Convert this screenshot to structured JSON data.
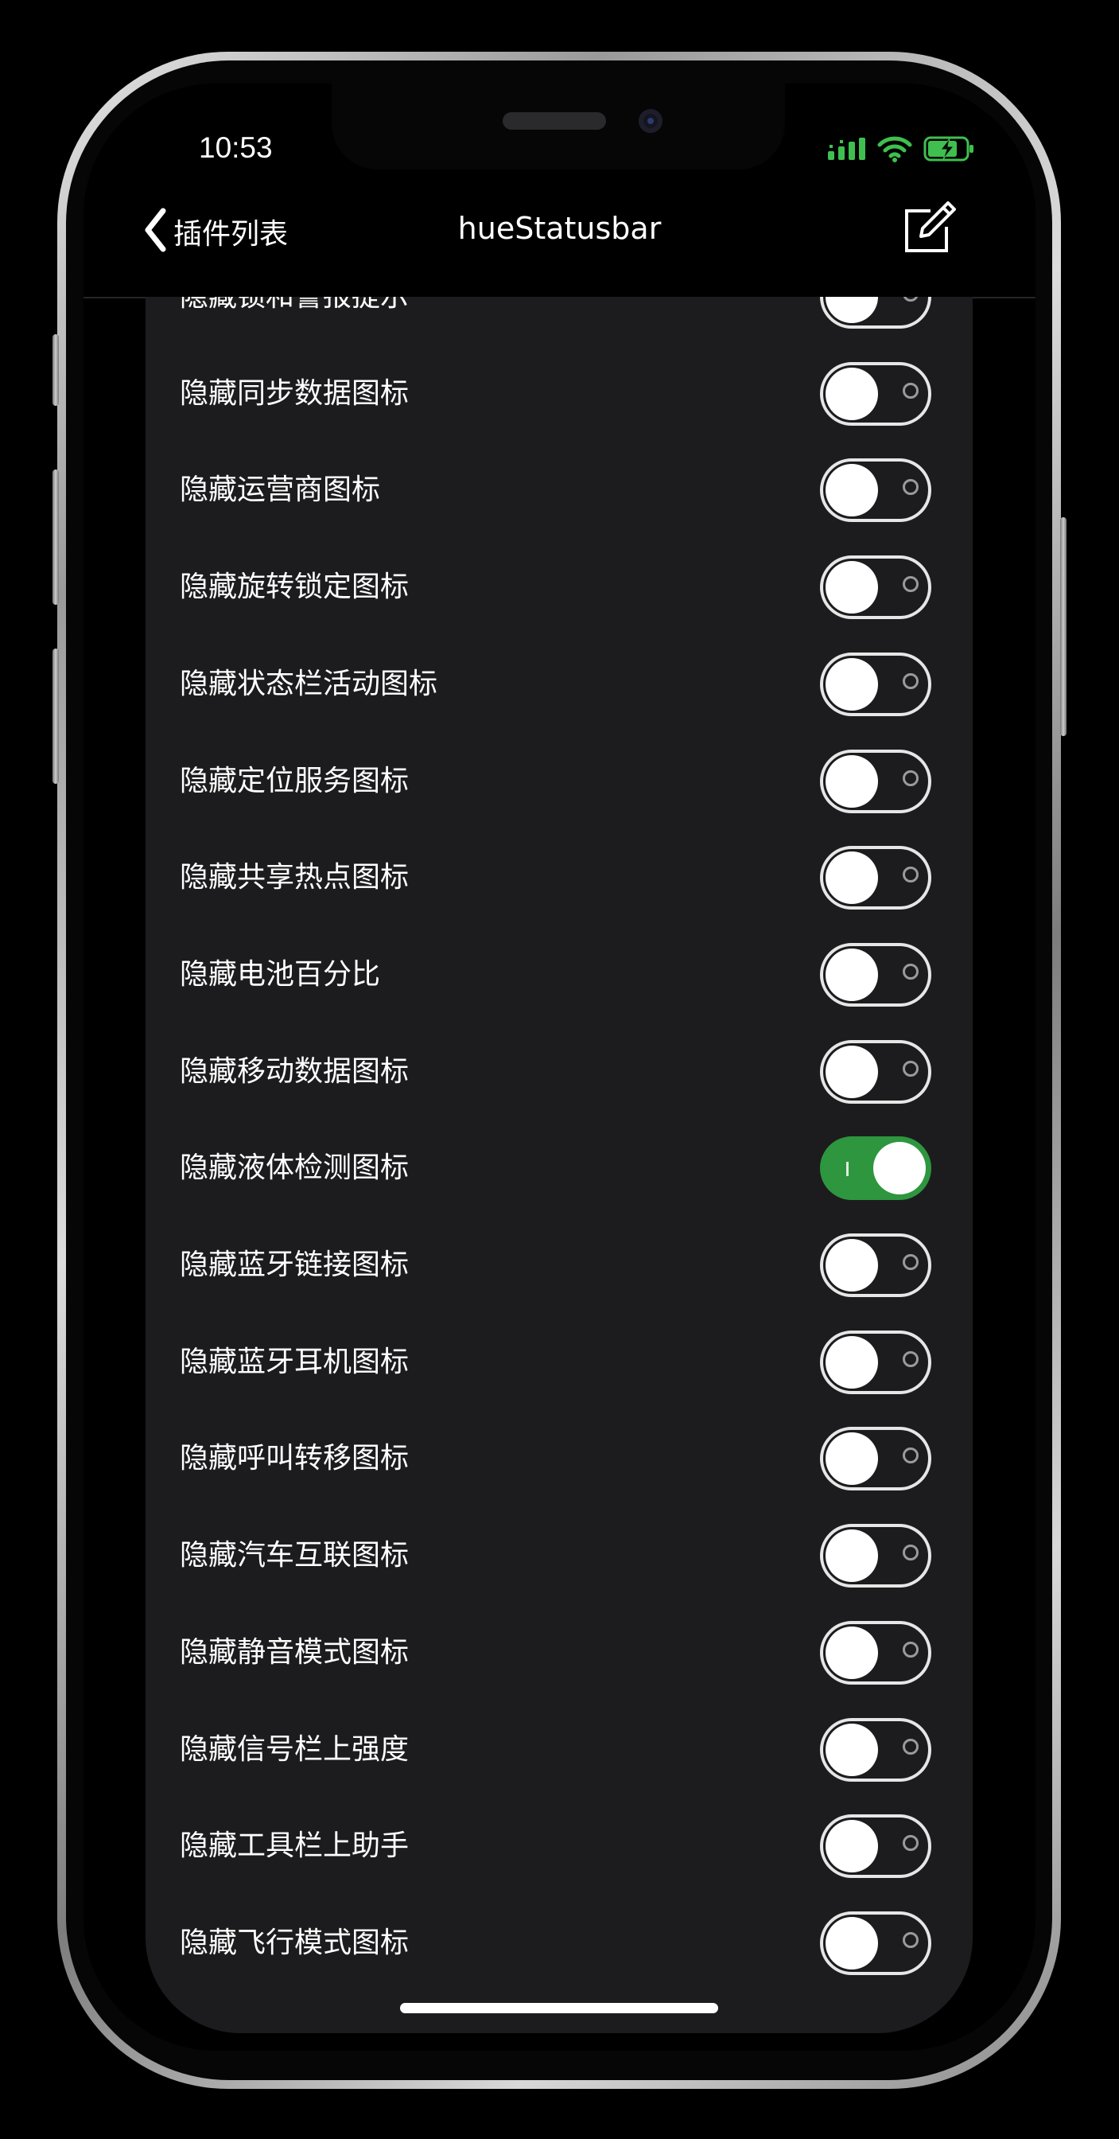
{
  "status_bar": {
    "time": "10:53"
  },
  "nav": {
    "back_label": "插件列表",
    "title": "hueStatusbar"
  },
  "settings": [
    {
      "label": "隐藏锁和警报提示",
      "on": false
    },
    {
      "label": "隐藏同步数据图标",
      "on": false
    },
    {
      "label": "隐藏运营商图标",
      "on": false
    },
    {
      "label": "隐藏旋转锁定图标",
      "on": false
    },
    {
      "label": "隐藏状态栏活动图标",
      "on": false
    },
    {
      "label": "隐藏定位服务图标",
      "on": false
    },
    {
      "label": "隐藏共享热点图标",
      "on": false
    },
    {
      "label": "隐藏电池百分比",
      "on": false
    },
    {
      "label": "隐藏移动数据图标",
      "on": false
    },
    {
      "label": "隐藏液体检测图标",
      "on": true
    },
    {
      "label": "隐藏蓝牙链接图标",
      "on": false
    },
    {
      "label": "隐藏蓝牙耳机图标",
      "on": false
    },
    {
      "label": "隐藏呼叫转移图标",
      "on": false
    },
    {
      "label": "隐藏汽车互联图标",
      "on": false
    },
    {
      "label": "隐藏静音模式图标",
      "on": false
    },
    {
      "label": "隐藏信号栏上强度",
      "on": false
    },
    {
      "label": "隐藏工具栏上助手",
      "on": false
    },
    {
      "label": "隐藏飞行模式图标",
      "on": false
    }
  ],
  "colors": {
    "switch_on": "#2e963e",
    "list_background": "#1c1c1e",
    "status_green": "#3fbf4f"
  }
}
